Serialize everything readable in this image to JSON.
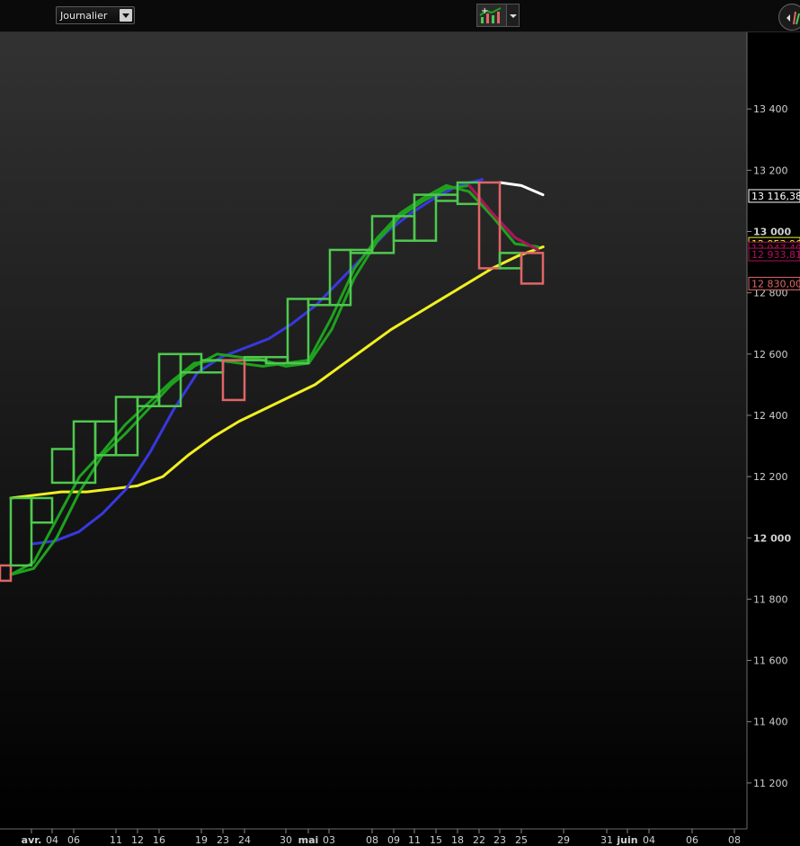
{
  "toolbar": {
    "period_select": "Journalier",
    "indicator_icon": "chart-indicators-icon",
    "dropdown_icon": "chevron-down-icon",
    "corner_icon": "navigation-icon"
  },
  "colors": {
    "up_candle": "#4ec94e",
    "down_candle": "#e06666",
    "ma_fast": "#1ea21e",
    "ma_fast_down": "#b0105c",
    "ma_mid": "#3838e0",
    "ma_slow": "#f0f020",
    "projection": "#ffffff",
    "grid": "#2a2a2a"
  },
  "chart_data": {
    "type": "candlestick",
    "ylim": [
      11050,
      13650
    ],
    "y_ticks": [
      11200,
      11400,
      11600,
      11800,
      12000,
      12200,
      12400,
      12600,
      12800,
      13000,
      13200,
      13400
    ],
    "y_tick_labels": [
      "11 200",
      "11 400",
      "11 600",
      "11 800",
      "12 000",
      "12 200",
      "12 400",
      "12 600",
      "12 800",
      "13 000",
      "13 200",
      "13 400"
    ],
    "bold_ticks": [
      12000,
      13000
    ],
    "x_labels": [
      "avr.",
      "04",
      "06",
      "11",
      "12",
      "16",
      "19",
      "23",
      "24",
      "30",
      "mai",
      "03",
      "08",
      "09",
      "11",
      "15",
      "18",
      "22",
      "23",
      "25",
      "29",
      "31",
      "juin",
      "04",
      "06",
      "08"
    ],
    "bold_x_labels": [
      "avr.",
      "mai",
      "juin"
    ],
    "candles": [
      {
        "open": 11910,
        "close": 11860,
        "dir": "down"
      },
      {
        "open": 11910,
        "close": 12130,
        "dir": "up"
      },
      {
        "open": 12050,
        "close": 12130,
        "dir": "up"
      },
      {
        "open": 12180,
        "close": 12290,
        "dir": "up"
      },
      {
        "open": 12180,
        "close": 12380,
        "dir": "up"
      },
      {
        "open": 12270,
        "close": 12380,
        "dir": "up"
      },
      {
        "open": 12270,
        "close": 12460,
        "dir": "up"
      },
      {
        "open": 12430,
        "close": 12460,
        "dir": "up"
      },
      {
        "open": 12430,
        "close": 12600,
        "dir": "up"
      },
      {
        "open": 12540,
        "close": 12600,
        "dir": "up"
      },
      {
        "open": 12540,
        "close": 12580,
        "dir": "up"
      },
      {
        "open": 12580,
        "close": 12450,
        "dir": "down"
      },
      {
        "open": 12580,
        "close": 12590,
        "dir": "up"
      },
      {
        "open": 12570,
        "close": 12590,
        "dir": "up"
      },
      {
        "open": 12570,
        "close": 12780,
        "dir": "up"
      },
      {
        "open": 12760,
        "close": 12780,
        "dir": "up"
      },
      {
        "open": 12760,
        "close": 12940,
        "dir": "up"
      },
      {
        "open": 12930,
        "close": 12940,
        "dir": "up"
      },
      {
        "open": 12930,
        "close": 13050,
        "dir": "up"
      },
      {
        "open": 12970,
        "close": 13050,
        "dir": "up"
      },
      {
        "open": 12970,
        "close": 13120,
        "dir": "up"
      },
      {
        "open": 13100,
        "close": 13120,
        "dir": "up"
      },
      {
        "open": 13090,
        "close": 13160,
        "dir": "up"
      },
      {
        "open": 13160,
        "close": 12880,
        "dir": "down"
      },
      {
        "open": 12880,
        "close": 12930,
        "dir": "up"
      },
      {
        "open": 12930,
        "close": 12830,
        "dir": "down"
      }
    ],
    "series": [
      {
        "key": "ma_fast",
        "values": [
          11880,
          11900,
          12000,
          12150,
          12270,
          12340,
          12420,
          12500,
          12560,
          12600,
          12590,
          12580,
          12560,
          12570,
          12680,
          12850,
          12970,
          13050,
          13100,
          13140,
          13150,
          13060,
          12980,
          12940
        ]
      },
      {
        "key": "ma_fast2",
        "values": [
          11880,
          11920,
          12060,
          12200,
          12280,
          12370,
          12440,
          12510,
          12570,
          12580,
          12570,
          12560,
          12570,
          12580,
          12720,
          12880,
          12980,
          13060,
          13110,
          13150,
          13130,
          13050,
          12960,
          12950
        ]
      },
      {
        "key": "ma_mid",
        "values": [
          11980,
          11990,
          12020,
          12080,
          12160,
          12280,
          12420,
          12540,
          12590,
          12620,
          12650,
          12700,
          12760,
          12840,
          12920,
          13000,
          13060,
          13110,
          13150,
          13170
        ]
      },
      {
        "key": "ma_slow",
        "values": [
          12130,
          12140,
          12150,
          12150,
          12160,
          12170,
          12200,
          12270,
          12330,
          12380,
          12420,
          12460,
          12500,
          12560,
          12620,
          12680,
          12730,
          12780,
          12830,
          12880,
          12920,
          12950
        ]
      },
      {
        "key": "projection",
        "values": [
          13160,
          13150,
          13120
        ]
      }
    ],
    "price_tags": [
      {
        "label": "13 116,38",
        "value": 13116,
        "color": "#ffffff",
        "bg": "#000000"
      },
      {
        "label": "12 953,96",
        "value": 12960,
        "color": "#f0f020",
        "bg": "#000000"
      },
      {
        "label": "12 947,40",
        "value": 12945,
        "color": "#b0105c",
        "bg": "#000000"
      },
      {
        "label": "12 933,81",
        "value": 12925,
        "color": "#b0105c",
        "bg": "#000000"
      },
      {
        "label": "12 830,00",
        "value": 12830,
        "color": "#e06666",
        "bg": "#000000"
      }
    ]
  }
}
